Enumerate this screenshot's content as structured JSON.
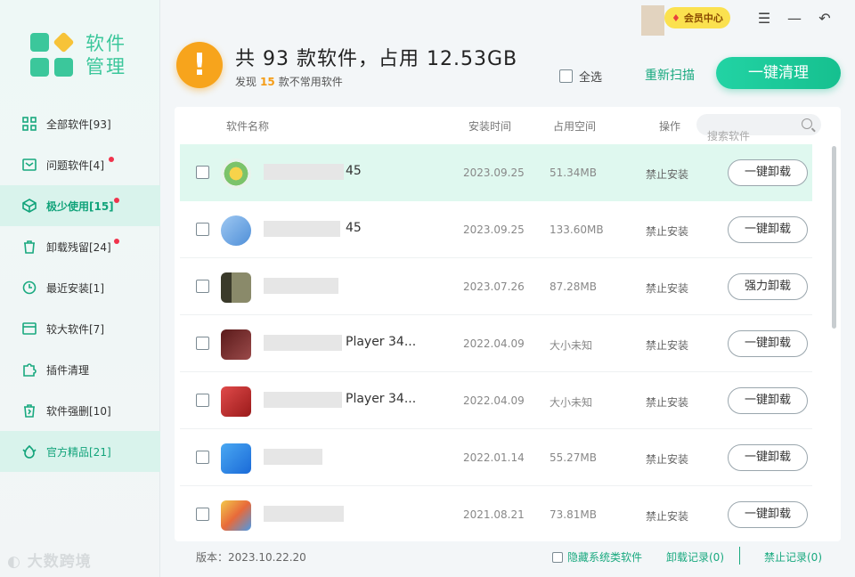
{
  "app": {
    "logo_text": "软件管理",
    "version": "版本：2023.10.22.20",
    "watermark": "大数跨境"
  },
  "sidebar": {
    "items": [
      {
        "label": "全部软件[93]",
        "icon": "grid-icon",
        "dot": false,
        "active": false
      },
      {
        "label": "问题软件[4]",
        "icon": "alert-box-icon",
        "dot": true,
        "active": false
      },
      {
        "label": "极少使用[15]",
        "icon": "cube-icon",
        "dot": true,
        "active": true
      },
      {
        "label": "卸载残留[24]",
        "icon": "trash-icon",
        "dot": true,
        "active": false
      },
      {
        "label": "最近安装[1]",
        "icon": "clock-icon",
        "dot": false,
        "active": false
      },
      {
        "label": "较大软件[7]",
        "icon": "window-icon",
        "dot": false,
        "active": false
      },
      {
        "label": "插件清理",
        "icon": "puzzle-icon",
        "dot": false,
        "active": false
      },
      {
        "label": "软件强删[10]",
        "icon": "force-delete-icon",
        "dot": false,
        "active": false
      },
      {
        "label": "官方精品[21]",
        "icon": "premium-icon",
        "dot": false,
        "active": true
      }
    ]
  },
  "header": {
    "title": "共 93 款软件，占用 12.53GB",
    "subtitle_prefix": "发现",
    "subtitle_count": "15",
    "subtitle_suffix": "款不常用软件",
    "vip_label": "会员中心",
    "select_all": "全选",
    "rescan": "重新扫描",
    "clean_button": "一键清理"
  },
  "table": {
    "columns": [
      "软件名称",
      "安装时间",
      "占用空间",
      "操作"
    ],
    "search_placeholder": "搜索软件",
    "rows": [
      {
        "name": "45",
        "date": "2023.09.25",
        "size": "51.34MB",
        "status": "禁止安装",
        "action": "一键卸载",
        "icon_color": "#7cc36a"
      },
      {
        "name": "45",
        "date": "2023.09.25",
        "size": "133.60MB",
        "status": "禁止安装",
        "action": "一键卸载",
        "icon_color": "#6aa7e8"
      },
      {
        "name": "",
        "date": "2023.07.26",
        "size": "87.28MB",
        "status": "禁止安装",
        "action": "强力卸载",
        "icon_color": "#4a5a3a"
      },
      {
        "name": "Player 34...",
        "date": "2022.04.09",
        "size": "大小未知",
        "status": "禁止安装",
        "action": "一键卸载",
        "icon_color": "#6b1f1f"
      },
      {
        "name": "Player 34...",
        "date": "2022.04.09",
        "size": "大小未知",
        "status": "禁止安装",
        "action": "一键卸载",
        "icon_color": "#b52828"
      },
      {
        "name": "",
        "date": "2022.01.14",
        "size": "55.27MB",
        "status": "禁止安装",
        "action": "一键卸载",
        "icon_color": "#2c8ae8"
      },
      {
        "name": "",
        "date": "2021.08.21",
        "size": "73.81MB",
        "status": "禁止安装",
        "action": "一键卸载",
        "icon_color": "#e96a3a"
      }
    ]
  },
  "footer": {
    "hide_system": "隐藏系统类软件",
    "uninstall_log": "卸载记录(0)",
    "block_log": "禁止记录(0)"
  },
  "colors": {
    "accent": "#16c08f",
    "warning": "#f7a41c",
    "highlight_row": "#dff8ef",
    "badge_dot": "#f0334c"
  }
}
